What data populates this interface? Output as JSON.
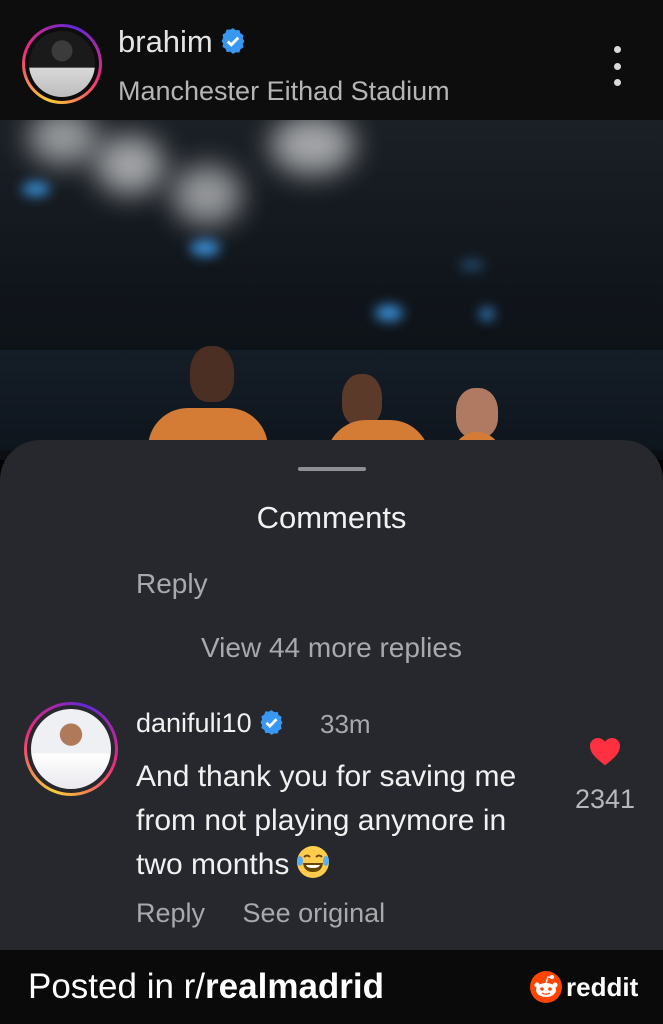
{
  "post": {
    "username": "brahim",
    "location": "Manchester Eithad Stadium"
  },
  "comments": {
    "title": "Comments",
    "previous_reply_label": "Reply",
    "view_more_label": "View 44 more replies",
    "comment": {
      "username": "danifuli10",
      "time": "33m",
      "text": "And thank you for saving me from not playing anymore in two months",
      "emoji_icon": "laughing-tears-icon",
      "reply_label": "Reply",
      "see_original_label": "See original",
      "like_count": "2341"
    }
  },
  "footer": {
    "posted_prefix": "Posted in r/",
    "subreddit": "realmadrid",
    "brand": "reddit"
  },
  "colors": {
    "verified_blue": "#3897f0",
    "like_red": "#ff3040",
    "reddit_orange": "#ff4500",
    "sheet_bg": "#26282d"
  }
}
